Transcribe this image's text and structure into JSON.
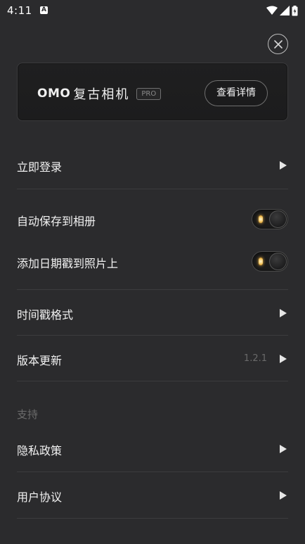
{
  "status_bar": {
    "time": "4:11",
    "notification_glyph": "A",
    "icons": [
      "wifi-icon",
      "cellular-signal-icon",
      "battery-icon"
    ]
  },
  "promo": {
    "brand_latin": "OMO",
    "brand_cn": "复古相机",
    "badge": "PRO",
    "details_button": "查看详情"
  },
  "menu": {
    "login": {
      "label": "立即登录"
    },
    "auto_save": {
      "label": "自动保存到相册",
      "enabled": true
    },
    "date_stamp": {
      "label": "添加日期戳到照片上",
      "enabled": true
    },
    "timestamp_format": {
      "label": "时间戳格式"
    },
    "version_update": {
      "label": "版本更新",
      "version": "1.2.1"
    }
  },
  "support": {
    "section_title": "支持",
    "privacy": {
      "label": "隐私政策"
    },
    "user_agreement": {
      "label": "用户协议"
    }
  },
  "colors": {
    "background": "#2b2b2d",
    "card": "#1f1f20",
    "divider": "#3c3c3e",
    "toggle_lamp": "#f3c25a",
    "muted_text": "#6b6b6b"
  }
}
